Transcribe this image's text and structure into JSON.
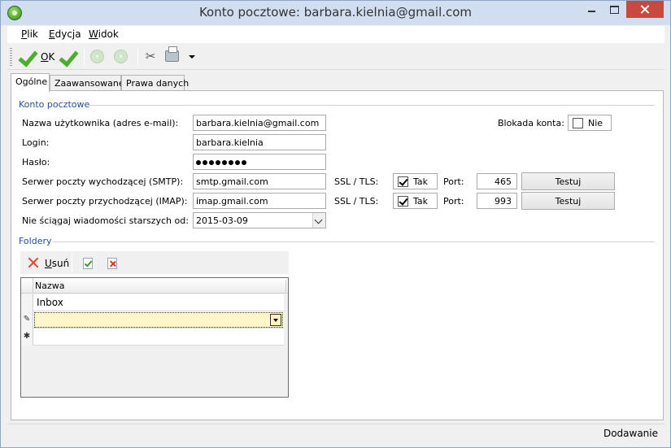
{
  "window": {
    "title": "Konto pocztowe: barbara.kielnia@gmail.com"
  },
  "menu": {
    "items": [
      {
        "label": "Plik",
        "accel": "P",
        "rest": "lik"
      },
      {
        "label": "Edycja",
        "accel": "E",
        "rest": "dycja"
      },
      {
        "label": "Widok",
        "accel": "W",
        "rest": "idok"
      }
    ]
  },
  "toolbar": {
    "ok_accel": "O",
    "ok_rest": "K"
  },
  "tabs": [
    {
      "label": "Ogólne",
      "active": true
    },
    {
      "label": "Zaawansowane",
      "active": false
    },
    {
      "label": "Prawa danych",
      "active": false
    }
  ],
  "account": {
    "group_title": "Konto pocztowe",
    "username_label": "Nazwa użytkownika (adres e-mail):",
    "username_value": "barbara.kielnia@gmail.com",
    "lock_label": "Blokada konta:",
    "lock_checked": false,
    "lock_text": "Nie",
    "login_label": "Login:",
    "login_value": "barbara.kielnia",
    "password_label": "Hasło:",
    "password_length": 8,
    "smtp_label": "Serwer poczty wychodzącej (SMTP):",
    "smtp_value": "smtp.gmail.com",
    "imap_label": "Serwer poczty przychodzącej (IMAP):",
    "imap_value": "imap.gmail.com",
    "ssl_label": "SSL / TLS:",
    "smtp_ssl_checked": true,
    "imap_ssl_checked": true,
    "ssl_text": "Tak",
    "port_label": "Port:",
    "smtp_port": "465",
    "imap_port": "993",
    "test_button": "Testuj",
    "older_label": "Nie ściągaj wiadomości starszych od:",
    "older_value": "2015-03-09"
  },
  "folders": {
    "group_title": "Foldery",
    "delete_accel": "U",
    "delete_rest": "suń",
    "column_header": "Nazwa",
    "rows": [
      "Inbox"
    ]
  },
  "status": {
    "text": "Dodawanie"
  }
}
